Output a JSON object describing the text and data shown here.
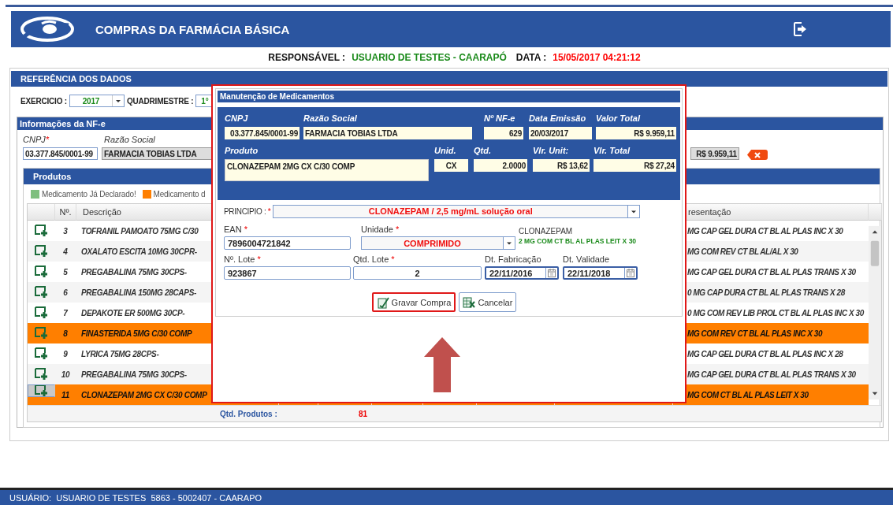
{
  "header": {
    "title": "COMPRAS DA FARMÁCIA BÁSICA"
  },
  "info_line": {
    "responsavel_label": "RESPONSÁVEL :",
    "responsavel": "USUARIO DE TESTES - CAARAPÓ",
    "data_label": "DATA :",
    "data": "15/05/2017 04:21:12"
  },
  "referencia": {
    "title": "REFERÊNCIA DOS DADOS",
    "exercicio_label": "EXERCICIO :",
    "exercicio": "2017",
    "quadrimestre_label": "QUADRIMESTRE :",
    "quadrimestre": "1°"
  },
  "nfe": {
    "title": "Informações da NF-e",
    "cnpj": {
      "label": "CNPJ",
      "required_mark": "*",
      "value": "03.377.845/0001-99"
    },
    "razao": {
      "label": "Razão Social",
      "value": "FARMACIA TOBIAS LTDA"
    },
    "valor": "R$ 9.959,11"
  },
  "produtos": {
    "title": "Produtos",
    "legend": [
      {
        "label": "Medicamento Já Declarado!",
        "color": "#7fbf7f"
      },
      {
        "label": "Medicamento d",
        "color": "#ff7f00"
      }
    ],
    "columns": [
      "Nº.",
      "Descrição",
      "resentação"
    ],
    "rows": [
      {
        "number": "3",
        "description": "TOFRANIL PAMOATO 75MG C/30",
        "presentation": "MG CAP GEL DURA CT BL AL PLAS INC X 30",
        "highlighted": false,
        "selected": false
      },
      {
        "number": "4",
        "description": "OXALATO ESCITA 10MG 30CPR-",
        "presentation": "MG COM REV CT BL AL/AL X 30",
        "highlighted": false,
        "selected": false
      },
      {
        "number": "5",
        "description": "PREGABALINA 75MG 30CPS-",
        "presentation": "MG CAP GEL DURA CT BL AL PLAS TRANS X 30",
        "highlighted": false,
        "selected": false
      },
      {
        "number": "6",
        "description": "PREGABALINA 150MG 28CAPS-",
        "presentation": "0 MG CAP DURA CT BL AL PLAS TRANS X 28",
        "highlighted": false,
        "selected": false
      },
      {
        "number": "7",
        "description": "DEPAKOTE ER 500MG 30CP-",
        "presentation": "0 MG COM REV LIB PROL CT BL AL PLAS INC X 30",
        "highlighted": false,
        "selected": false
      },
      {
        "number": "8",
        "description": "FINASTERIDA 5MG C/30 COMP",
        "presentation": "MG COM REV CT BL AL PLAS INC X 30",
        "highlighted": true,
        "selected": false
      },
      {
        "number": "9",
        "description": "LYRICA 75MG 28CPS-",
        "presentation": "MG CAP GEL DURA CT BL AL PLAS INC X 28",
        "highlighted": false,
        "selected": false
      },
      {
        "number": "10",
        "description": "PREGABALINA 75MG 30CPS-",
        "presentation": "MG CAP GEL DURA CT BL AL PLAS TRANS X 30",
        "highlighted": false,
        "selected": false
      },
      {
        "number": "11",
        "description": "CLONAZEPAM 2MG CX C/30 COMP",
        "presentation": "MG COM CT BL AL PLAS LEIT X 30",
        "highlighted": true,
        "selected": true
      }
    ],
    "total_label": "Qtd. Produtos :",
    "total": "81"
  },
  "dialog": {
    "title": "Manutenção de Medicamentos",
    "nfe_fields": [
      {
        "label": "CNPJ",
        "value": "03.377.845/0001-99"
      },
      {
        "label": "Razão Social",
        "value": "FARMACIA TOBIAS LTDA"
      },
      {
        "label": "Nº NF-e",
        "value": "629"
      },
      {
        "label": "Data Emissão",
        "value": "20/03/2017"
      },
      {
        "label": "Valor Total",
        "value": "R$ 9.959,11"
      }
    ],
    "product_fields": [
      {
        "label": "Produto",
        "value": "CLONAZEPAM 2MG CX C/30 COMP"
      },
      {
        "label": "Unid.",
        "value": "CX"
      },
      {
        "label": "Qtd.",
        "value": "2.0000"
      },
      {
        "label": "Vlr. Unit:",
        "value": "R$ 13,62"
      },
      {
        "label": "Vlr. Total",
        "value": "R$ 27,24"
      }
    ],
    "principio": {
      "label": "PRINCIPIO :",
      "required_mark": "*",
      "value": "CLONAZEPAM / 2,5 mg/mL  solução oral"
    },
    "ean": {
      "label": "EAN",
      "required_mark": "*",
      "value": "7896004721842"
    },
    "unidade": {
      "label": "Unidade",
      "required_mark": "*",
      "value": "COMPRIMIDO"
    },
    "note": {
      "title": "CLONAZEPAM",
      "detail": "2 MG COM CT BL AL PLAS LEIT X 30"
    },
    "lote": {
      "label": "Nº. Lote",
      "required_mark": "*",
      "value": "923867"
    },
    "qtd_lote": {
      "label": "Qtd. Lote",
      "required_mark": "*",
      "value": "2"
    },
    "fabricacao": {
      "label": "Dt. Fabricação",
      "value": "22/11/2016"
    },
    "validade": {
      "label": "Dt. Validade",
      "value": "22/11/2018"
    },
    "buttons": [
      {
        "label": "Gravar Compra",
        "kind": "save",
        "highlighted": true
      },
      {
        "label": "Cancelar",
        "kind": "cancel",
        "highlighted": false
      }
    ]
  },
  "status_bar": {
    "label": "USUÁRIO:",
    "user": "USUARIO DE TESTES  5863 - 5002407 - CAARAPO"
  }
}
